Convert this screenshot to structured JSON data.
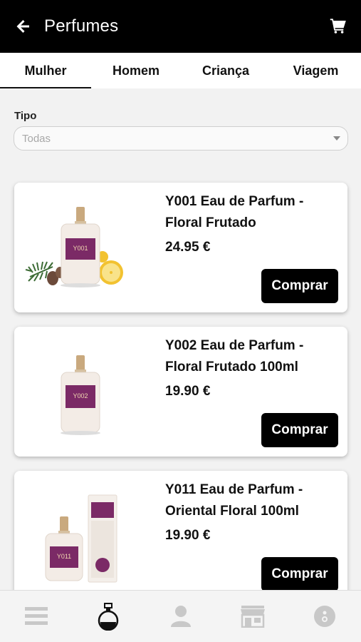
{
  "header": {
    "title": "Perfumes",
    "back_icon": "arrow-left-icon",
    "cart_icon": "cart-icon"
  },
  "tabs": [
    {
      "label": "Mulher",
      "active": true
    },
    {
      "label": "Homem",
      "active": false
    },
    {
      "label": "Criança",
      "active": false
    },
    {
      "label": "Viagem",
      "active": false
    }
  ],
  "filter": {
    "label": "Tipo",
    "selected": "Todas"
  },
  "products": [
    {
      "name": "Y001 Eau de Parfum - Floral Frutado",
      "price": "24.95 €",
      "buy_label": "Comprar",
      "bottle_label": "Y001"
    },
    {
      "name": "Y002 Eau de Parfum - Floral Frutado 100ml",
      "price": "19.90 €",
      "buy_label": "Comprar",
      "bottle_label": "Y002"
    },
    {
      "name": "Y011 Eau de Parfum - Oriental Floral 100ml",
      "price": "19.90 €",
      "buy_label": "Comprar",
      "bottle_label": "Y011"
    }
  ],
  "bottom_nav": [
    {
      "icon": "menu-icon",
      "active": false
    },
    {
      "icon": "perfume-bottle-icon",
      "active": true
    },
    {
      "icon": "user-icon",
      "active": false
    },
    {
      "icon": "store-icon",
      "active": false
    },
    {
      "icon": "info-icon",
      "active": false
    }
  ],
  "colors": {
    "header_bg": "#000000",
    "button_bg": "#000000",
    "label_purple": "#7b2a66",
    "inactive_icon": "#c8c8c8"
  }
}
